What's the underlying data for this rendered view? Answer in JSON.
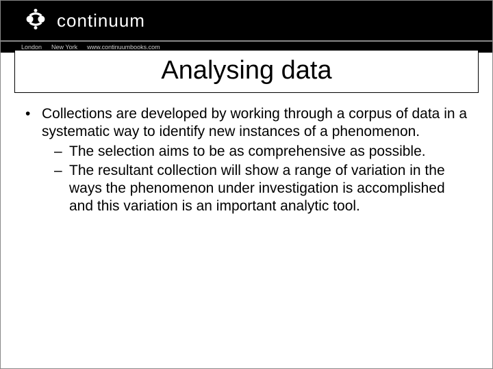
{
  "brand": {
    "name": "continuum",
    "subitems": [
      "London",
      "New York",
      "www.continuumbooks.com"
    ]
  },
  "title": "Analysing data",
  "bullets": [
    {
      "text": "Collections are developed by working through a corpus of data in a systematic way to identify new instances of a phenomenon.",
      "children": [
        {
          "text": "The selection aims to be as comprehensive as possible."
        },
        {
          "text": "The resultant collection will show a range of variation in the ways the phenomenon under investigation is accomplished and this variation is an important analytic tool."
        }
      ]
    }
  ]
}
